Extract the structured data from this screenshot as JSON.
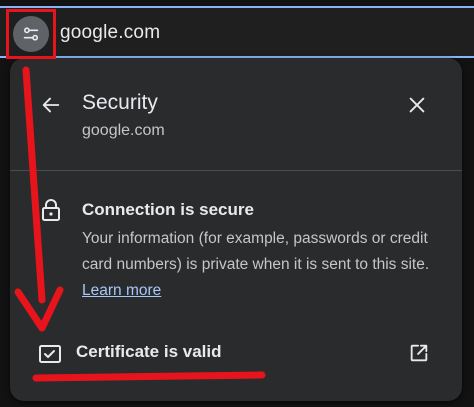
{
  "omnibox": {
    "url": "google.com",
    "site_info_icon": "tune-icon"
  },
  "panel": {
    "title": "Security",
    "subtitle": "google.com",
    "back_icon": "arrow-left-icon",
    "close_icon": "close-icon",
    "connection": {
      "icon": "lock-icon",
      "title": "Connection is secure",
      "description": "Your information (for example, passwords or credit card numbers) is private when it is sent to this site.",
      "learn_more": "Learn more"
    },
    "certificate": {
      "icon": "certificate-icon",
      "label": "Certificate is valid",
      "action_icon": "open-external-icon"
    }
  },
  "colors": {
    "annotation": "#e8141b",
    "link": "#a8c7fa",
    "focus_ring": "#8ab4f8",
    "panel_bg": "#2a2b2d"
  }
}
